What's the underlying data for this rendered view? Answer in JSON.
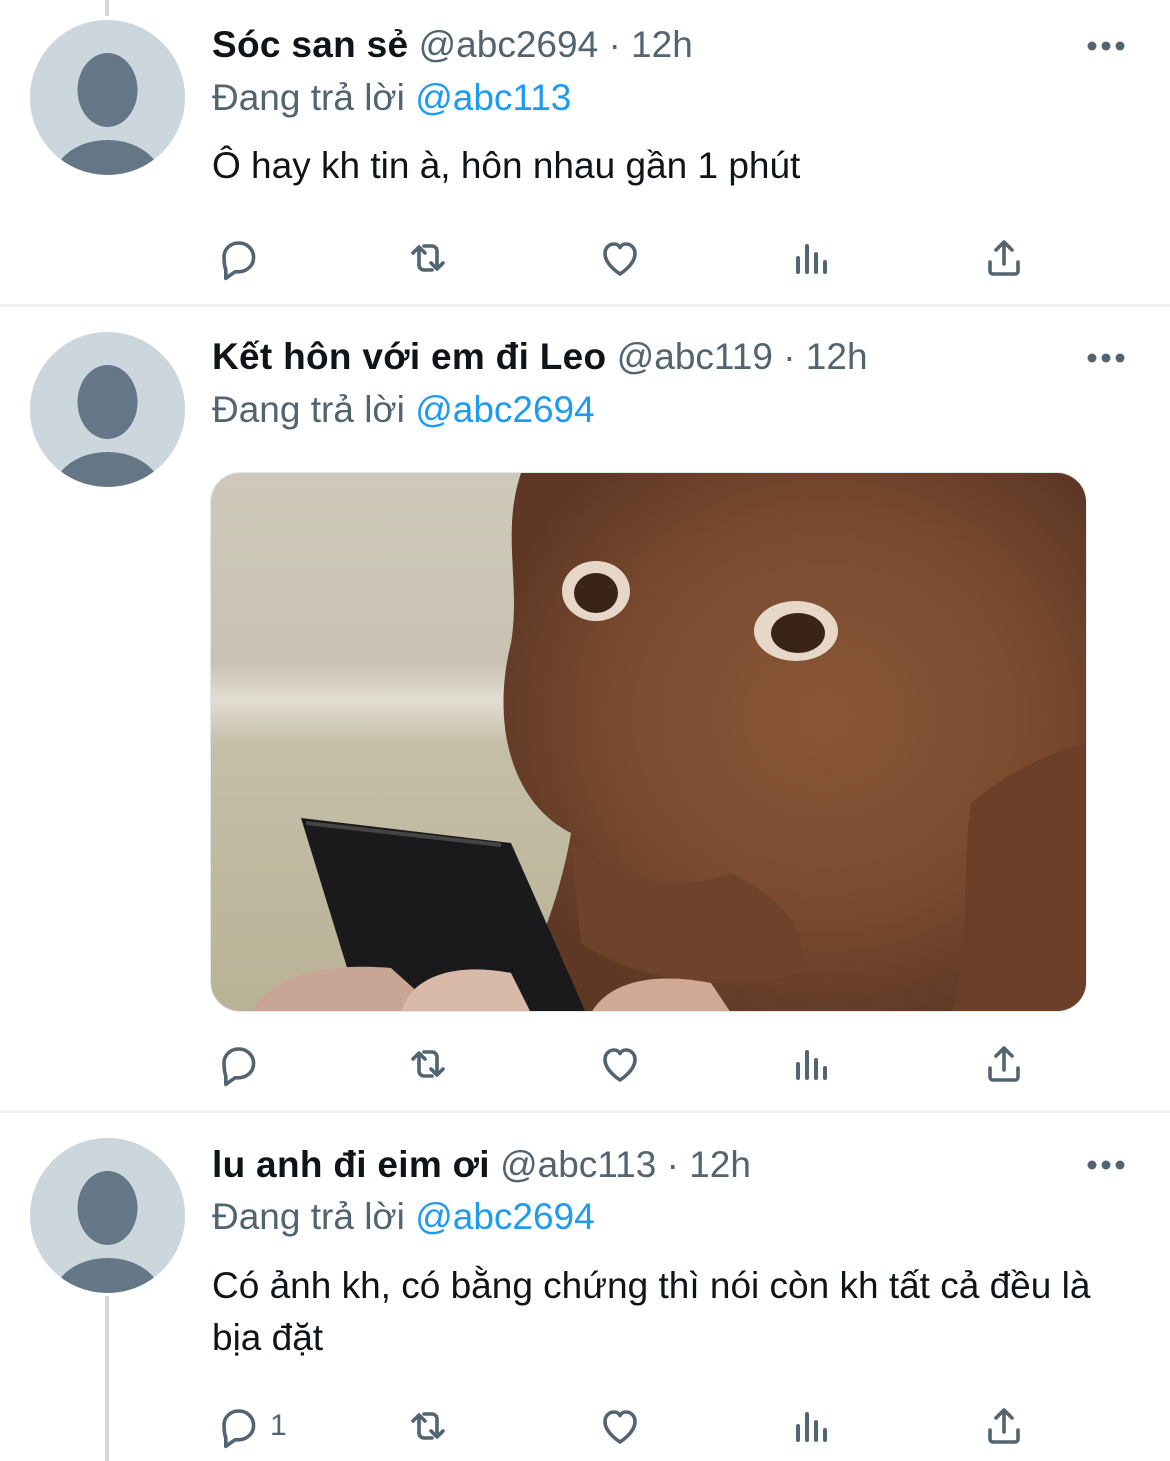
{
  "tweets": [
    {
      "name": "Sóc san sẻ",
      "handle": "@abc2694",
      "dot": "·",
      "time": "12h",
      "replying_label": "Đang trả lời",
      "replying_to": "@abc113",
      "text": "Ô hay kh tin à, hôn nhau gần 1 phút",
      "reply_count": ""
    },
    {
      "name": "Kết hôn với em đi Leo",
      "handle": "@abc119",
      "dot": "·",
      "time": "12h",
      "replying_label": "Đang trả lời",
      "replying_to": "@abc2694",
      "text": "",
      "media": "photo of a brown dog staring at a smartphone",
      "reply_count": ""
    },
    {
      "name": "lu anh đi eim ơi",
      "handle": "@abc113",
      "dot": "·",
      "time": "12h",
      "replying_label": "Đang trả lời",
      "replying_to": "@abc2694",
      "text": "Có ảnh kh, có bằng chứng thì nói còn kh tất cả đều là bịa đặt",
      "reply_count": "1"
    }
  ],
  "icons": {
    "reply": "reply-icon",
    "retweet": "retweet-icon",
    "like": "heart-icon",
    "views": "views-icon",
    "share": "share-icon",
    "more": "more-icon"
  },
  "colors": {
    "icon": "#536471",
    "mention": "#1d9bf0",
    "avatar_bg": "#ccd6dd",
    "avatar_fg": "#657786",
    "separator": "#eff3f4"
  }
}
